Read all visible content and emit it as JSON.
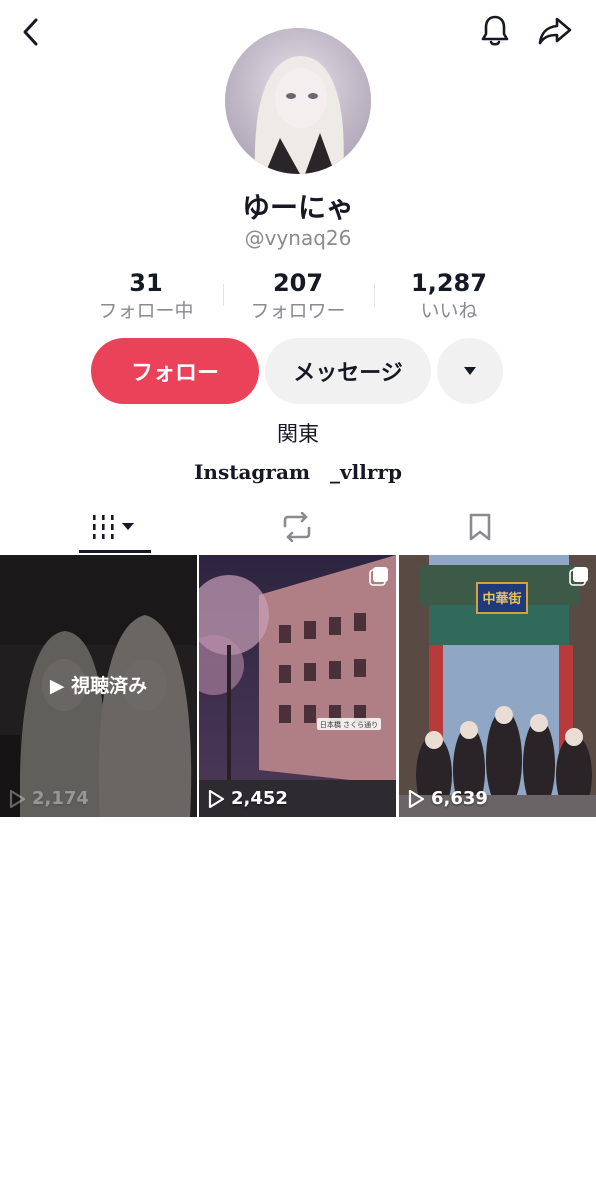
{
  "profile": {
    "display_name": "ゆーにゃ",
    "username": "@vynaq26"
  },
  "stats": {
    "following": {
      "value": "31",
      "label": "フォロー中"
    },
    "followers": {
      "value": "207",
      "label": "フォロワー"
    },
    "likes": {
      "value": "1,287",
      "label": "いいね"
    }
  },
  "actions": {
    "follow_label": "フォロー",
    "message_label": "メッセージ",
    "more_icon": "caret-down-icon"
  },
  "bio": {
    "region": "関東",
    "instagram": "Instagram　_vllrrp"
  },
  "tabs": [
    {
      "icon": "videos-grid-icon",
      "selected": true
    },
    {
      "icon": "repost-icon",
      "selected": false
    },
    {
      "icon": "bookmark-icon",
      "selected": false
    }
  ],
  "videos": [
    {
      "views": "2,174",
      "watched_label": "▶ 視聴済み",
      "multi": false
    },
    {
      "views": "2,452",
      "map_label": "日本橋 さくら通り",
      "multi": true
    },
    {
      "views": "6,639",
      "gate_sign": "中華街",
      "multi": true
    }
  ],
  "colors": {
    "accent": "#ea4359",
    "text": "#161823",
    "muted": "#8a8b91",
    "button_bg": "#f1f1f2"
  }
}
